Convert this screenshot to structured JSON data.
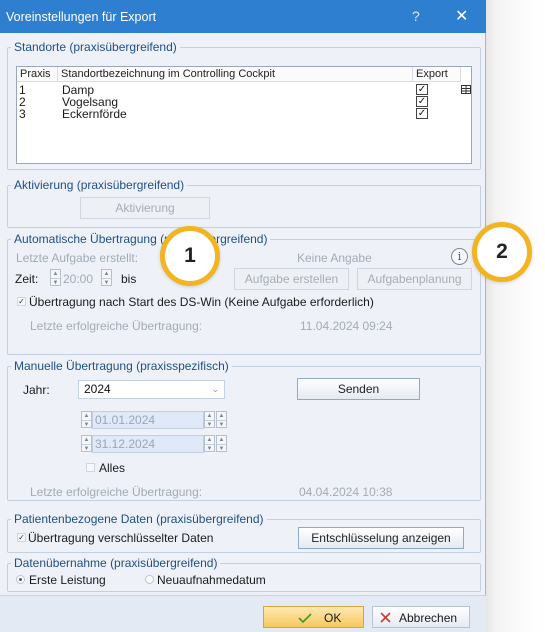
{
  "window": {
    "title": "Voreinstellungen für Export",
    "help_glyph": "?",
    "close_glyph": "✕"
  },
  "standorte": {
    "group_label": "Standorte (praxisübergreifend)",
    "columns": {
      "praxis": "Praxis",
      "bezeichnung": "Standortbezeichnung im Controlling Cockpit",
      "export": "Export"
    },
    "rows": [
      {
        "praxis": "1",
        "name": "Damp",
        "export": true
      },
      {
        "praxis": "2",
        "name": "Vogelsang",
        "export": true
      },
      {
        "praxis": "3",
        "name": "Eckernförde",
        "export": true
      }
    ],
    "check_glyph": "✓",
    "table_icon": "table-export-icon"
  },
  "aktivierung": {
    "group_label": "Aktivierung (praxisübergreifend)",
    "button": "Aktivierung"
  },
  "automatisch": {
    "group_label": "Automatische Übertragung (praxisübergreifend)",
    "letzte_aufgabe_label": "Letzte Aufgabe erstellt:",
    "letzte_aufgabe_value": "Keine Angabe",
    "zeit_label": "Zeit:",
    "zeit_from": "20:00",
    "bis_label": "bis",
    "btn_erstellen": "Aufgabe erstellen",
    "btn_planung": "Aufgabenplanung",
    "start_check_label": "Übertragung nach Start des DS-Win  (Keine Aufgabe erforderlich)",
    "start_check": true,
    "letzte_label": "Letzte erfolgreiche Übertragung:",
    "letzte_value": "11.04.2024 09:24",
    "info_icon": "info-icon"
  },
  "manuell": {
    "group_label": "Manuelle Übertragung (praxisspezifisch)",
    "jahr_label": "Jahr:",
    "jahr_value": "2024",
    "btn_senden": "Senden",
    "date_from": "01.01.2024",
    "date_to": "31.12.2024",
    "alles_label": "Alles",
    "letzte_label": "Letzte erfolgreiche Übertragung:",
    "letzte_value": "04.04.2024 10:38"
  },
  "patienten": {
    "group_label": "Patientenbezogene Daten (praxisübergreifend)",
    "check_label": "Übertragung verschlüsselter Daten",
    "checked": true,
    "btn": "Entschlüsselung anzeigen"
  },
  "daten": {
    "group_label": "Datenübernahme (praxisübergreifend)",
    "radio1": "Erste Leistung",
    "radio2": "Neuaufnahmedatum",
    "selected": "Erste Leistung"
  },
  "footer": {
    "ok": "OK",
    "cancel": "Abbrechen",
    "ok_icon": "check-icon",
    "cancel_icon": "x-icon"
  },
  "callouts": [
    "1",
    "2"
  ],
  "colors": {
    "titlebar": "#2f7fd0",
    "accent_label": "#1f4f86",
    "callout": "#f2b420",
    "ok_button": "#f7c95e"
  }
}
